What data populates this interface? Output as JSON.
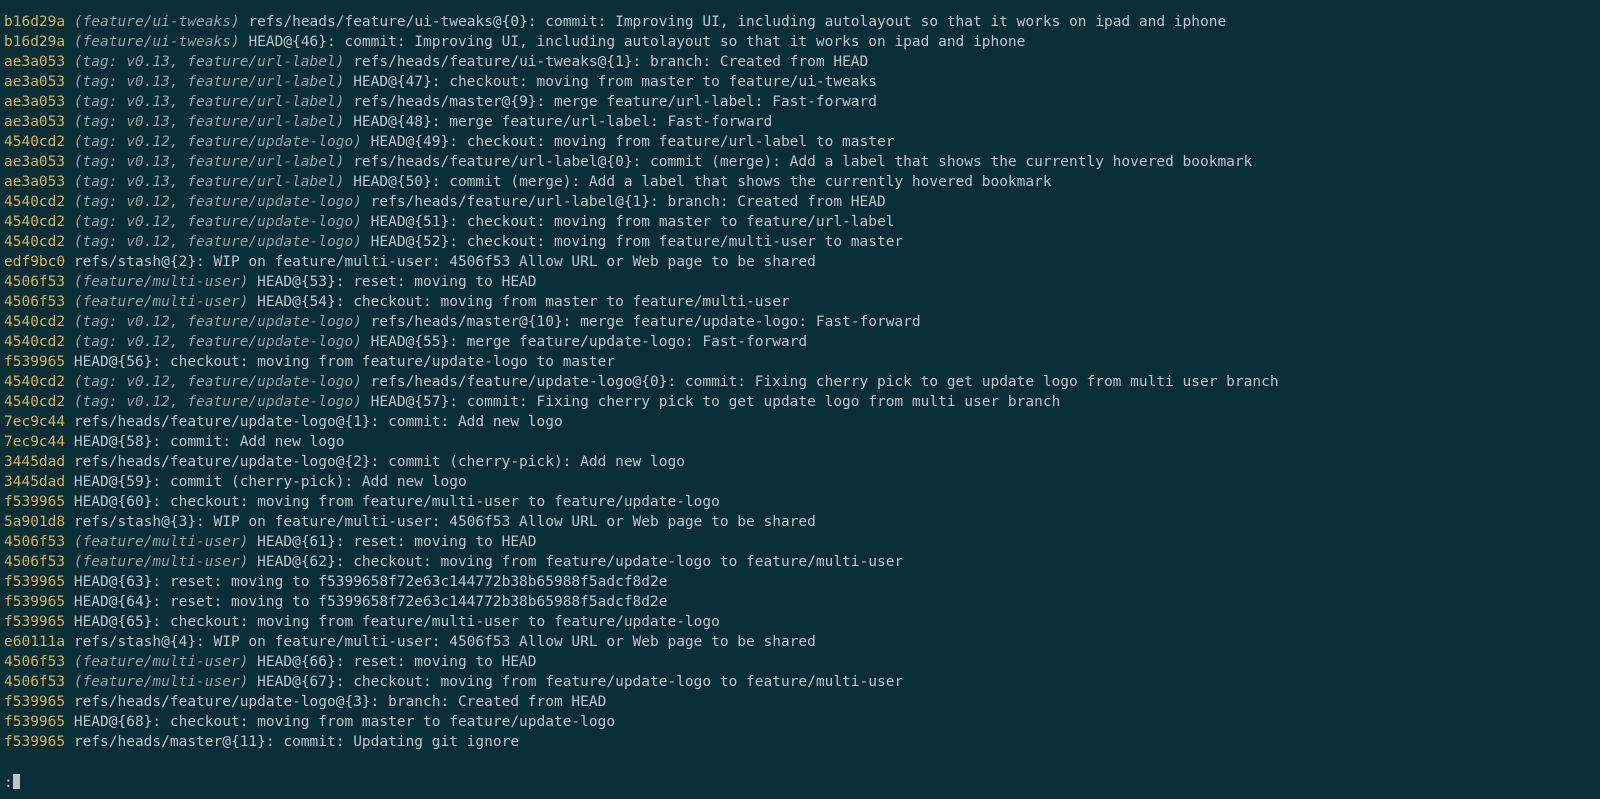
{
  "prompt": ":",
  "rows": [
    {
      "hash": "b16d29a",
      "decor": " (feature/ui-tweaks)",
      "rest": " refs/heads/feature/ui-tweaks@{0}: commit: Improving UI, including autolayout so that it works on ipad and iphone"
    },
    {
      "hash": "b16d29a",
      "decor": " (feature/ui-tweaks)",
      "rest": " HEAD@{46}: commit: Improving UI, including autolayout so that it works on ipad and iphone"
    },
    {
      "hash": "ae3a053",
      "decor": " (tag: v0.13, feature/url-label)",
      "rest": " refs/heads/feature/ui-tweaks@{1}: branch: Created from HEAD"
    },
    {
      "hash": "ae3a053",
      "decor": " (tag: v0.13, feature/url-label)",
      "rest": " HEAD@{47}: checkout: moving from master to feature/ui-tweaks"
    },
    {
      "hash": "ae3a053",
      "decor": " (tag: v0.13, feature/url-label)",
      "rest": " refs/heads/master@{9}: merge feature/url-label: Fast-forward"
    },
    {
      "hash": "ae3a053",
      "decor": " (tag: v0.13, feature/url-label)",
      "rest": " HEAD@{48}: merge feature/url-label: Fast-forward"
    },
    {
      "hash": "4540cd2",
      "decor": " (tag: v0.12, feature/update-logo)",
      "rest": " HEAD@{49}: checkout: moving from feature/url-label to master"
    },
    {
      "hash": "ae3a053",
      "decor": " (tag: v0.13, feature/url-label)",
      "rest": " refs/heads/feature/url-label@{0}: commit (merge): Add a label that shows the currently hovered bookmark"
    },
    {
      "hash": "ae3a053",
      "decor": " (tag: v0.13, feature/url-label)",
      "rest": " HEAD@{50}: commit (merge): Add a label that shows the currently hovered bookmark"
    },
    {
      "hash": "4540cd2",
      "decor": " (tag: v0.12, feature/update-logo)",
      "rest": " refs/heads/feature/url-label@{1}: branch: Created from HEAD"
    },
    {
      "hash": "4540cd2",
      "decor": " (tag: v0.12, feature/update-logo)",
      "rest": " HEAD@{51}: checkout: moving from master to feature/url-label"
    },
    {
      "hash": "4540cd2",
      "decor": " (tag: v0.12, feature/update-logo)",
      "rest": " HEAD@{52}: checkout: moving from feature/multi-user to master"
    },
    {
      "hash": "edf9bc0",
      "decor": "",
      "rest": " refs/stash@{2}: WIP on feature/multi-user: 4506f53 Allow URL or Web page to be shared"
    },
    {
      "hash": "4506f53",
      "decor": " (feature/multi-user)",
      "rest": " HEAD@{53}: reset: moving to HEAD"
    },
    {
      "hash": "4506f53",
      "decor": " (feature/multi-user)",
      "rest": " HEAD@{54}: checkout: moving from master to feature/multi-user"
    },
    {
      "hash": "4540cd2",
      "decor": " (tag: v0.12, feature/update-logo)",
      "rest": " refs/heads/master@{10}: merge feature/update-logo: Fast-forward"
    },
    {
      "hash": "4540cd2",
      "decor": " (tag: v0.12, feature/update-logo)",
      "rest": " HEAD@{55}: merge feature/update-logo: Fast-forward"
    },
    {
      "hash": "f539965",
      "decor": "",
      "rest": " HEAD@{56}: checkout: moving from feature/update-logo to master"
    },
    {
      "hash": "4540cd2",
      "decor": " (tag: v0.12, feature/update-logo)",
      "rest": " refs/heads/feature/update-logo@{0}: commit: Fixing cherry pick to get update logo from multi user branch"
    },
    {
      "hash": "4540cd2",
      "decor": " (tag: v0.12, feature/update-logo)",
      "rest": " HEAD@{57}: commit: Fixing cherry pick to get update logo from multi user branch"
    },
    {
      "hash": "7ec9c44",
      "decor": "",
      "rest": " refs/heads/feature/update-logo@{1}: commit: Add new logo"
    },
    {
      "hash": "7ec9c44",
      "decor": "",
      "rest": " HEAD@{58}: commit: Add new logo"
    },
    {
      "hash": "3445dad",
      "decor": "",
      "rest": " refs/heads/feature/update-logo@{2}: commit (cherry-pick): Add new logo"
    },
    {
      "hash": "3445dad",
      "decor": "",
      "rest": " HEAD@{59}: commit (cherry-pick): Add new logo"
    },
    {
      "hash": "f539965",
      "decor": "",
      "rest": " HEAD@{60}: checkout: moving from feature/multi-user to feature/update-logo"
    },
    {
      "hash": "5a901d8",
      "decor": "",
      "rest": " refs/stash@{3}: WIP on feature/multi-user: 4506f53 Allow URL or Web page to be shared"
    },
    {
      "hash": "4506f53",
      "decor": " (feature/multi-user)",
      "rest": " HEAD@{61}: reset: moving to HEAD"
    },
    {
      "hash": "4506f53",
      "decor": " (feature/multi-user)",
      "rest": " HEAD@{62}: checkout: moving from feature/update-logo to feature/multi-user"
    },
    {
      "hash": "f539965",
      "decor": "",
      "rest": " HEAD@{63}: reset: moving to f5399658f72e63c144772b38b65988f5adcf8d2e"
    },
    {
      "hash": "f539965",
      "decor": "",
      "rest": " HEAD@{64}: reset: moving to f5399658f72e63c144772b38b65988f5adcf8d2e"
    },
    {
      "hash": "f539965",
      "decor": "",
      "rest": " HEAD@{65}: checkout: moving from feature/multi-user to feature/update-logo"
    },
    {
      "hash": "e60111a",
      "decor": "",
      "rest": " refs/stash@{4}: WIP on feature/multi-user: 4506f53 Allow URL or Web page to be shared"
    },
    {
      "hash": "4506f53",
      "decor": " (feature/multi-user)",
      "rest": " HEAD@{66}: reset: moving to HEAD"
    },
    {
      "hash": "4506f53",
      "decor": " (feature/multi-user)",
      "rest": " HEAD@{67}: checkout: moving from feature/update-logo to feature/multi-user"
    },
    {
      "hash": "f539965",
      "decor": "",
      "rest": " refs/heads/feature/update-logo@{3}: branch: Created from HEAD"
    },
    {
      "hash": "f539965",
      "decor": "",
      "rest": " HEAD@{68}: checkout: moving from master to feature/update-logo"
    },
    {
      "hash": "f539965",
      "decor": "",
      "rest": " refs/heads/master@{11}: commit: Updating git ignore"
    }
  ]
}
